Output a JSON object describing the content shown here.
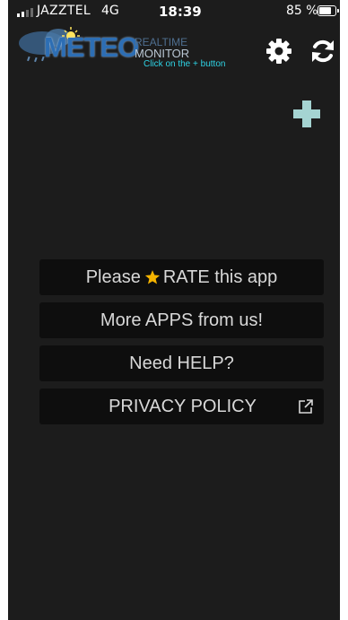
{
  "status_bar": {
    "carrier": "JAZZTEL",
    "network": "4G",
    "time": "18:39",
    "battery": "85 %",
    "battery_level_fraction": 0.85
  },
  "logo": {
    "word": "METEO",
    "realtime": "REALTIME",
    "monitor": "MONITOR",
    "hint": "Click on the + button"
  },
  "toolbar": {
    "settings_icon": "gear-icon",
    "refresh_icon": "refresh-icon",
    "add_icon": "plus-icon"
  },
  "menu": {
    "rate": {
      "before": "Please",
      "after": "RATE this app",
      "icon": "star-icon"
    },
    "more_apps": "More APPS from us!",
    "help": "Need HELP?",
    "privacy": "PRIVACY POLICY",
    "privacy_icon": "external-link-icon"
  },
  "colors": {
    "background": "#1c1c1c",
    "button_bg": "#0e0e0e",
    "button_text": "#d8d8d8",
    "plus": "#a5d4d2",
    "hint": "#2ed4e6",
    "star": "#f5b400",
    "logo_blue": "#2d6eb4"
  }
}
